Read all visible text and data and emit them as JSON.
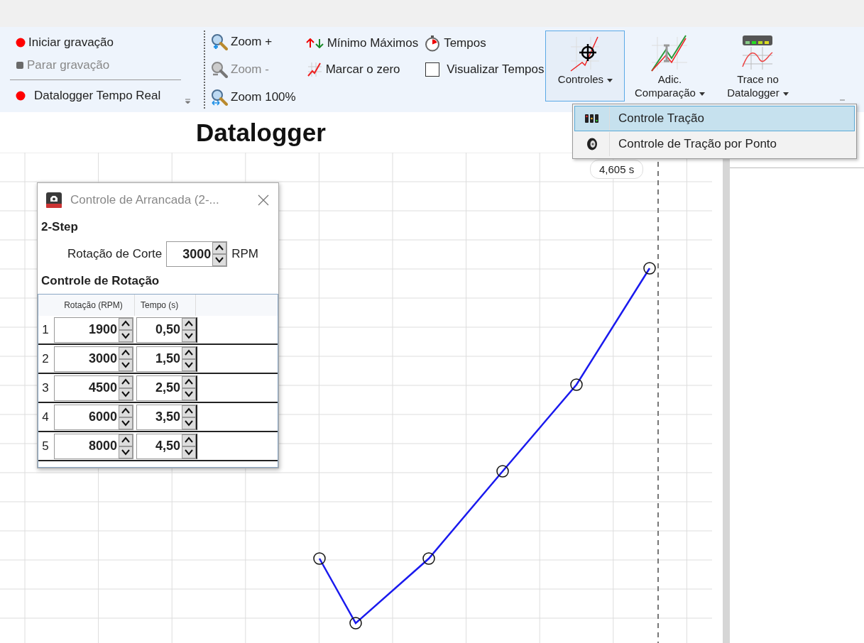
{
  "toolbar": {
    "recording": [
      {
        "label": "Iniciar gravação",
        "kind": "start",
        "disabled": false
      },
      {
        "label": "Parar gravação",
        "kind": "stop",
        "disabled": true
      }
    ],
    "realtime": {
      "label": "Datalogger Tempo Real"
    },
    "zoom": [
      {
        "label": "Zoom +",
        "kind": "in",
        "disabled": false
      },
      {
        "label": "Zoom -",
        "kind": "out",
        "disabled": true
      },
      {
        "label": "Zoom 100%",
        "kind": "reset",
        "disabled": false
      }
    ],
    "tools": [
      {
        "label": "Mínimo Máximos",
        "kind": "minmax"
      },
      {
        "label": "Marcar o zero",
        "kind": "zero"
      }
    ],
    "tempos": {
      "label": "Tempos"
    },
    "visualizar_tempos": {
      "label": "Visualizar Tempos",
      "checked": false
    },
    "large_buttons": [
      {
        "label": "Controles",
        "kind": "controls",
        "selected": true
      },
      {
        "label": "Adic. Comparação",
        "kind": "compare",
        "selected": false
      },
      {
        "label": "Trace no Datalogger",
        "kind": "trace",
        "selected": false
      }
    ]
  },
  "dropdown_menu": {
    "items": [
      {
        "label": "Controle Tração",
        "kind": "traction",
        "selected": true
      },
      {
        "label": "Controle de Tração por Ponto",
        "kind": "point",
        "selected": false
      }
    ]
  },
  "chart": {
    "title": "Datalogger",
    "cursor_label": "4,605 s"
  },
  "dialog": {
    "title": "Controle de Arrancada (2-...",
    "section_1": "2-Step",
    "cut_label": "Rotação de Corte",
    "cut_value": "3000",
    "cut_unit": "RPM",
    "section_2": "Controle de Rotação",
    "columns": [
      "Rotação (RPM)",
      "Tempo (s)"
    ],
    "rows": [
      {
        "index": "1",
        "rpm": "1900",
        "time": "0,50"
      },
      {
        "index": "2",
        "rpm": "3000",
        "time": "1,50"
      },
      {
        "index": "3",
        "rpm": "4500",
        "time": "2,50"
      },
      {
        "index": "4",
        "rpm": "6000",
        "time": "3,50"
      },
      {
        "index": "5",
        "rpm": "8000",
        "time": "4,50"
      }
    ]
  }
}
